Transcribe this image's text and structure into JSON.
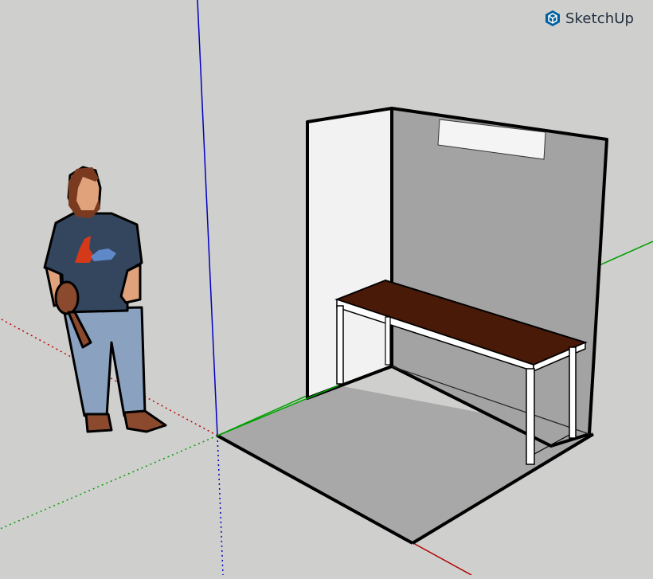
{
  "app": {
    "name": "SketchUp",
    "logo_icon": "sketchup-cube-icon",
    "accent_color": "#005f9e"
  },
  "viewport": {
    "background_color": "#cfcfcd",
    "axes": {
      "red_axis_color": "#b00000",
      "green_axis_color": "#00a000",
      "blue_axis_color": "#0000c0"
    },
    "model": {
      "floor_color": "#a8a8a8",
      "left_wall_color": "#f2f2f2",
      "back_wall_color": "#a3a3a3",
      "window_color": "#f4f4f4",
      "desk_top_color": "#4a1a08",
      "desk_frame_color": "#ffffff"
    },
    "scale_figure": {
      "shirt_color": "#34465e",
      "jeans_color": "#8aa1bf",
      "boots_color": "#8b4a2d"
    }
  }
}
